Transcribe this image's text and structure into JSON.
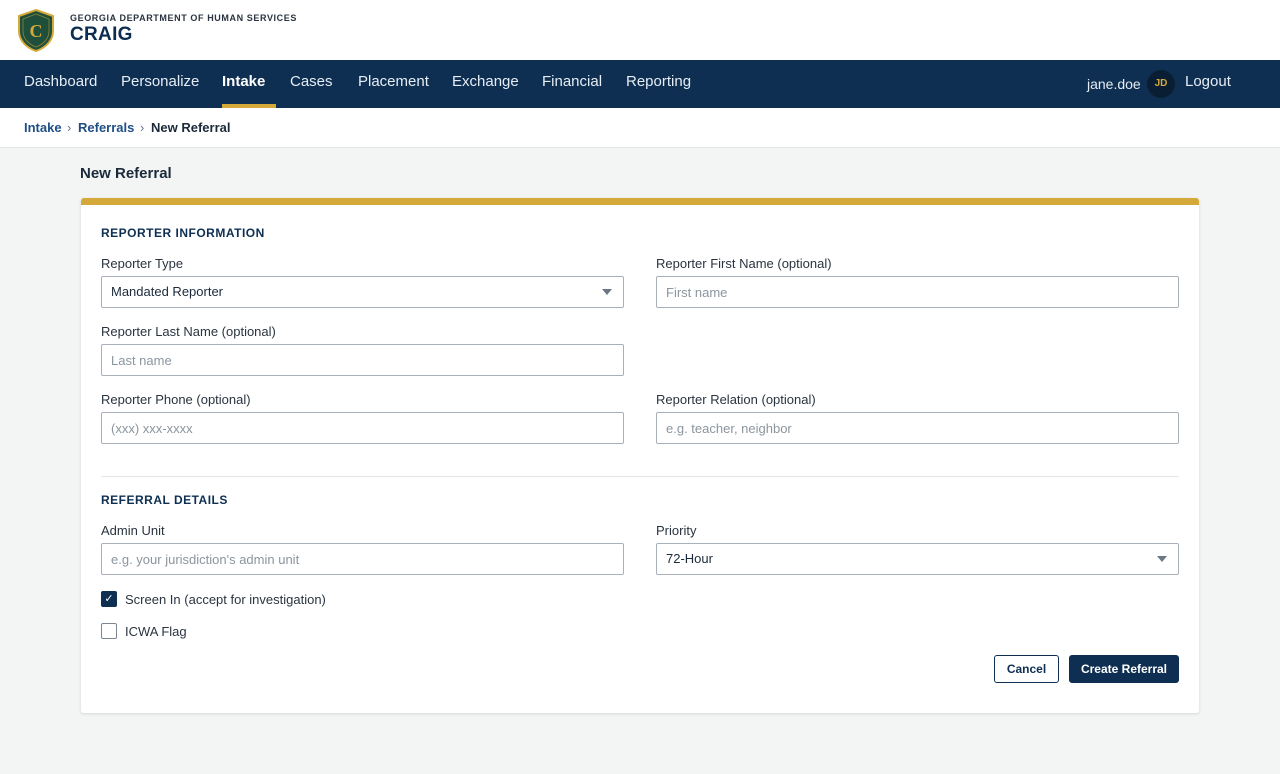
{
  "header": {
    "org": "GEORGIA DEPARTMENT OF HUMAN SERVICES",
    "app_name": "CRAIG",
    "logo_letter": "C"
  },
  "nav": {
    "items": [
      "Dashboard",
      "Personalize",
      "Intake",
      "Cases",
      "Placement",
      "Exchange",
      "Financial",
      "Reporting"
    ],
    "active": "Intake",
    "username": "jane.doe",
    "avatar_initials": "JD",
    "logout_label": "Logout"
  },
  "breadcrumb": {
    "items": [
      "Intake",
      "Referrals",
      "New Referral"
    ],
    "separator": "›"
  },
  "page": {
    "title": "New Referral"
  },
  "reporter": {
    "section_title": "REPORTER INFORMATION",
    "type": {
      "label": "Reporter Type",
      "value": "Mandated Reporter"
    },
    "first_name": {
      "label": "Reporter First Name (optional)",
      "placeholder": "First name",
      "value": ""
    },
    "last_name": {
      "label": "Reporter Last Name (optional)",
      "placeholder": "Last name",
      "value": ""
    },
    "phone": {
      "label": "Reporter Phone (optional)",
      "placeholder": "(xxx) xxx-xxxx",
      "value": ""
    },
    "relation": {
      "label": "Reporter Relation (optional)",
      "placeholder": "e.g. teacher, neighbor",
      "value": ""
    }
  },
  "referral": {
    "section_title": "REFERRAL DETAILS",
    "admin_unit": {
      "label": "Admin Unit",
      "placeholder": "e.g. your jurisdiction's admin unit",
      "value": ""
    },
    "priority": {
      "label": "Priority",
      "value": "72-Hour"
    },
    "screen_in": {
      "label": "Screen In (accept for investigation)",
      "checked": true,
      "check_glyph": "✓"
    },
    "icwa": {
      "label": "ICWA Flag",
      "checked": false
    }
  },
  "actions": {
    "cancel_label": "Cancel",
    "create_label": "Create Referral"
  },
  "colors": {
    "navy": "#0e2f52",
    "gold": "#d4a93a",
    "link": "#1f4f86",
    "page_bg": "#f3f5f4"
  }
}
